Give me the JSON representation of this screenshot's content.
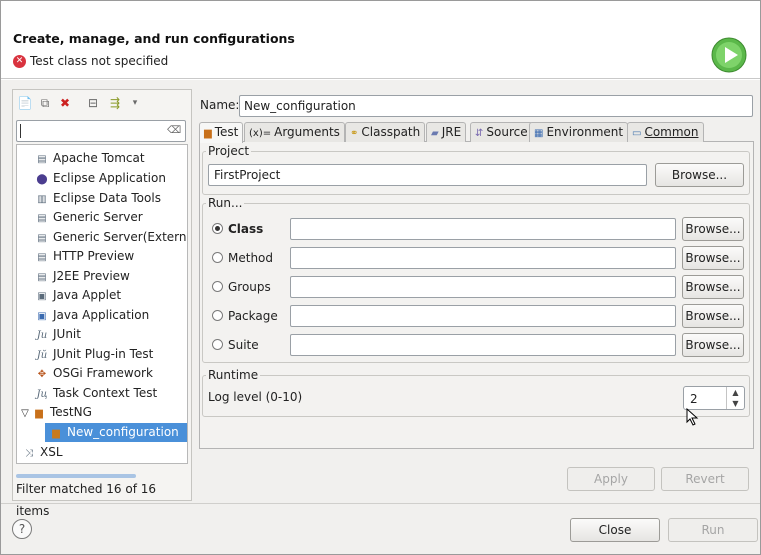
{
  "header": {
    "title": "Create, manage, and run configurations",
    "message": "Test class not specified"
  },
  "left": {
    "filter_placeholder": "",
    "tree": [
      {
        "label": "Apache Tomcat",
        "icon": "server-icon"
      },
      {
        "label": "Eclipse Application",
        "icon": "eclipse-icon"
      },
      {
        "label": "Eclipse Data Tools",
        "icon": "database-icon"
      },
      {
        "label": "Generic Server",
        "icon": "server-icon"
      },
      {
        "label": "Generic Server(External",
        "icon": "server-icon"
      },
      {
        "label": "HTTP Preview",
        "icon": "server-icon"
      },
      {
        "label": "J2EE Preview",
        "icon": "server-icon"
      },
      {
        "label": "Java Applet",
        "icon": "applet-icon"
      },
      {
        "label": "Java Application",
        "icon": "java-app-icon"
      },
      {
        "label": "JUnit",
        "icon": "junit-icon"
      },
      {
        "label": "JUnit Plug-in Test",
        "icon": "junit-plugin-icon"
      },
      {
        "label": "OSGi Framework",
        "icon": "osgi-icon"
      },
      {
        "label": "Task Context Test",
        "icon": "task-context-icon"
      },
      {
        "label": "TestNG",
        "icon": "testng-icon"
      },
      {
        "label": "New_configuration",
        "icon": "testng-icon"
      },
      {
        "label": "XSL",
        "icon": "xsl-icon"
      }
    ],
    "status": "Filter matched 16 of 16 items"
  },
  "main": {
    "name_label": "Name:",
    "name_value": "New_configuration",
    "tabs": [
      {
        "label": "Test",
        "icon": "testng-icon"
      },
      {
        "label": "Arguments",
        "icon": "arguments-icon"
      },
      {
        "label": "Classpath",
        "icon": "classpath-icon"
      },
      {
        "label": "JRE",
        "icon": "jre-icon"
      },
      {
        "label": "Source",
        "icon": "source-icon"
      },
      {
        "label": "Environment",
        "icon": "environment-icon"
      },
      {
        "label": "Common",
        "icon": "common-icon"
      }
    ],
    "project": {
      "title": "Project",
      "value": "FirstProject",
      "browse": "Browse..."
    },
    "run": {
      "title": "Run...",
      "options": [
        {
          "label": "Class",
          "selected": true,
          "value": ""
        },
        {
          "label": "Method",
          "selected": false,
          "value": ""
        },
        {
          "label": "Groups",
          "selected": false,
          "value": ""
        },
        {
          "label": "Package",
          "selected": false,
          "value": ""
        },
        {
          "label": "Suite",
          "selected": false,
          "value": ""
        }
      ],
      "browse": "Browse..."
    },
    "runtime": {
      "title": "Runtime",
      "log_label": "Log level (0-10)",
      "log_value": "2"
    },
    "apply": "Apply",
    "revert": "Revert"
  },
  "footer": {
    "close": "Close",
    "run": "Run"
  }
}
